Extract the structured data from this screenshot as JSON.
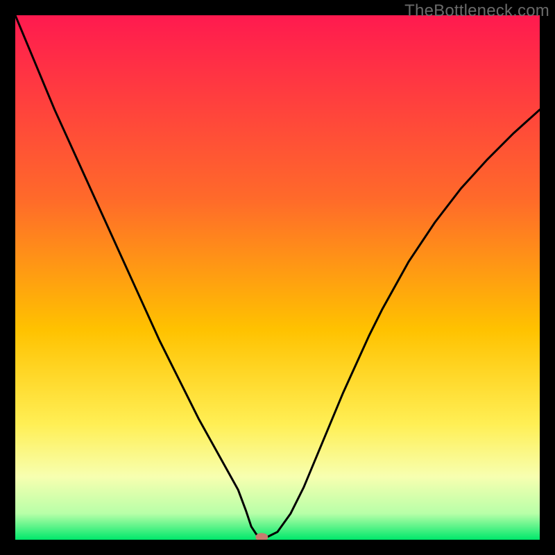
{
  "watermark": "TheBottleneck.com",
  "chart_data": {
    "type": "line",
    "title": "",
    "xlabel": "",
    "ylabel": "",
    "xlim": [
      0,
      100
    ],
    "ylim": [
      0,
      100
    ],
    "grid": false,
    "legend": false,
    "background": {
      "type": "vertical_gradient",
      "stops": [
        {
          "pos": 0.0,
          "color": "#ff1a4f"
        },
        {
          "pos": 0.35,
          "color": "#ff6a2a"
        },
        {
          "pos": 0.6,
          "color": "#ffc200"
        },
        {
          "pos": 0.78,
          "color": "#ffef55"
        },
        {
          "pos": 0.88,
          "color": "#f7ffb0"
        },
        {
          "pos": 0.95,
          "color": "#b8ffa8"
        },
        {
          "pos": 1.0,
          "color": "#00e86b"
        }
      ]
    },
    "series": [
      {
        "name": "bottleneck-curve",
        "color": "#000000",
        "x": [
          0,
          2.5,
          5,
          7.5,
          10,
          12.5,
          15,
          17.5,
          20,
          22.5,
          25,
          27.5,
          30,
          32.5,
          35,
          37.5,
          40,
          42.5,
          44,
          45,
          46,
          47,
          48,
          50,
          52.5,
          55,
          57.5,
          60,
          62.5,
          65,
          67.5,
          70,
          75,
          80,
          85,
          90,
          95,
          100
        ],
        "y": [
          100,
          94,
          88,
          82,
          76.5,
          71,
          65.5,
          60,
          54.5,
          49,
          43.5,
          38,
          33,
          28,
          23,
          18.5,
          14,
          9.5,
          5.5,
          2.5,
          1,
          0.5,
          0.5,
          1.5,
          5,
          10,
          16,
          22,
          28,
          33.5,
          39,
          44,
          53,
          60.5,
          67,
          72.5,
          77.5,
          82
        ]
      }
    ],
    "marker": {
      "name": "optimal-point",
      "x": 47,
      "y": 0.5,
      "color": "#c77b6e",
      "rx": 9,
      "ry": 6
    }
  }
}
